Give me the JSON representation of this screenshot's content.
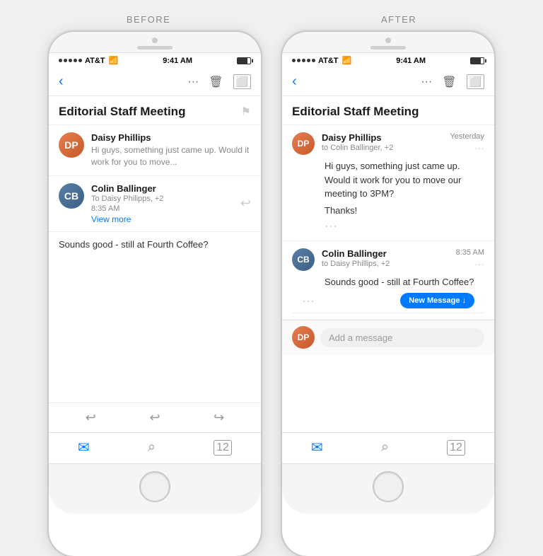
{
  "labels": {
    "before": "BEFORE",
    "after": "AFTER"
  },
  "before_phone": {
    "status": {
      "carrier": "AT&T",
      "time": "9:41 AM"
    },
    "toolbar": {
      "back": "<",
      "more": "···",
      "trash": "🗑",
      "archive": "⬜"
    },
    "thread_title": "Editorial Staff Meeting",
    "messages": [
      {
        "sender": "Daisy Phillips",
        "preview": "Hi guys, something just came up. Would it work for you to move...",
        "avatar_initials": "DP"
      },
      {
        "sender": "Colin Ballinger",
        "to": "To Daisy Philipps, +2",
        "time": "8:35 AM",
        "view_more": "View more",
        "avatar_initials": "CB"
      }
    ],
    "plain_msg": "Sounds good - still at Fourth Coffee?",
    "bottom_actions": [
      "↩",
      "↩",
      "↪"
    ],
    "tabs": [
      "mail",
      "search",
      "calendar"
    ]
  },
  "after_phone": {
    "status": {
      "carrier": "AT&T",
      "time": "9:41 AM"
    },
    "toolbar": {
      "back": "<",
      "more": "···",
      "trash": "🗑",
      "archive": "⬜"
    },
    "thread_title": "Editorial Staff Meeting",
    "msg1": {
      "sender": "Daisy Phillips",
      "date": "Yesterday",
      "to": "to Colin Ballinger, +2",
      "text": "Hi guys, something just came up. Would it work for you to move our meeting to 3PM?",
      "thanks": "Thanks!",
      "avatar_initials": "DP"
    },
    "msg2": {
      "sender": "Colin Ballinger",
      "time": "8:35 AM",
      "to": "to Daisy Phillips, +2",
      "text": "Sounds good - still at Fourth Coffee?",
      "avatar_initials": "CB"
    },
    "new_msg_btn": "New Message ↓",
    "compose_placeholder": "Add a message",
    "tabs": [
      "mail",
      "search",
      "calendar"
    ]
  }
}
